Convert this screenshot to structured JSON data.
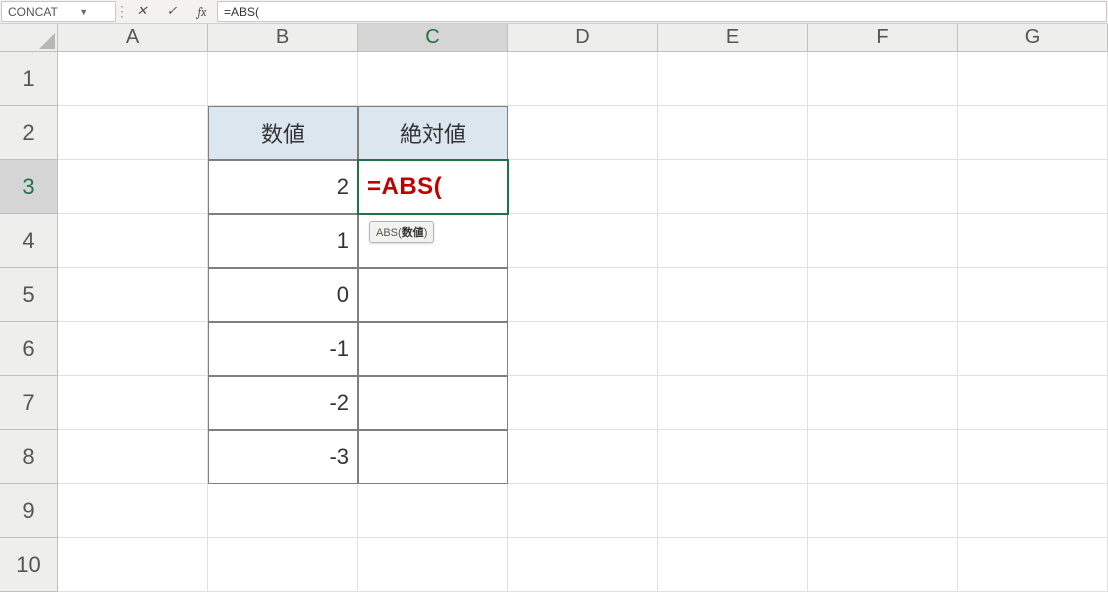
{
  "formula_bar": {
    "name_box": "CONCAT",
    "cancel_glyph": "✕",
    "enter_glyph": "✓",
    "fx_label": "fx",
    "formula": "=ABS("
  },
  "columns": [
    "A",
    "B",
    "C",
    "D",
    "E",
    "F",
    "G"
  ],
  "row_numbers": [
    "1",
    "2",
    "3",
    "4",
    "5",
    "6",
    "7",
    "8",
    "9",
    "10"
  ],
  "active_col_index": 2,
  "active_row_index": 2,
  "table": {
    "headers": {
      "b": "数値",
      "c": "絶対値"
    },
    "values_b": [
      "2",
      "1",
      "0",
      "-1",
      "-2",
      "-3"
    ]
  },
  "editing": {
    "display": "=ABS(",
    "tooltip_fn": "ABS(",
    "tooltip_arg": "数値",
    "tooltip_close": ")"
  }
}
